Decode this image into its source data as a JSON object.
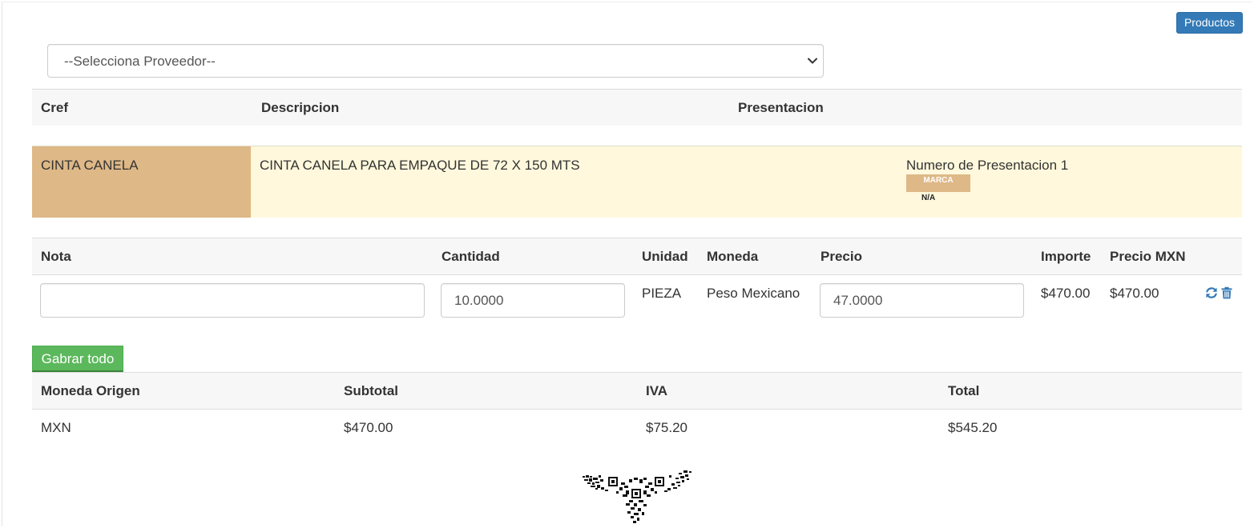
{
  "toolbar": {
    "productos_label": "Productos"
  },
  "proveedor_select": {
    "selected": "--Selecciona Proveedor--"
  },
  "product_table": {
    "headers": {
      "cref": "Cref",
      "descripcion": "Descripcion",
      "presentacion": "Presentacion"
    },
    "row": {
      "cref": "CINTA CANELA",
      "descripcion": "CINTA CANELA PARA EMPAQUE DE 72 X 150 MTS",
      "presentacion": "Numero de Presentacion 1",
      "marca_label": "MARCA",
      "marca_value": "N/A"
    }
  },
  "detail_table": {
    "headers": {
      "nota": "Nota",
      "cantidad": "Cantidad",
      "unidad": "Unidad",
      "moneda": "Moneda",
      "precio": "Precio",
      "importe": "Importe",
      "precio_mxn": "Precio MXN"
    },
    "row": {
      "nota": "",
      "cantidad": "10.0000",
      "unidad": "PIEZA",
      "moneda": "Peso Mexicano",
      "precio": "47.0000",
      "importe": "$470.00",
      "precio_mxn": "$470.00"
    },
    "icons": {
      "refresh": "refresh-icon",
      "delete": "trash-icon"
    }
  },
  "actions": {
    "grabar_label": "Gabrar todo"
  },
  "totals_table": {
    "headers": {
      "moneda_origen": "Moneda Origen",
      "subtotal": "Subtotal",
      "iva": "IVA",
      "total": "Total"
    },
    "row": {
      "moneda_origen": "MXN",
      "subtotal": "$470.00",
      "iva": "$75.20",
      "total": "$545.20"
    }
  },
  "colors": {
    "primary": "#337ab7",
    "success": "#5cb85c",
    "cref_cell": "#deb887",
    "row_highlight": "#fff8dc",
    "header_bg": "#f7f7f7"
  },
  "logo": {
    "name": "qr-eagle-logo"
  }
}
